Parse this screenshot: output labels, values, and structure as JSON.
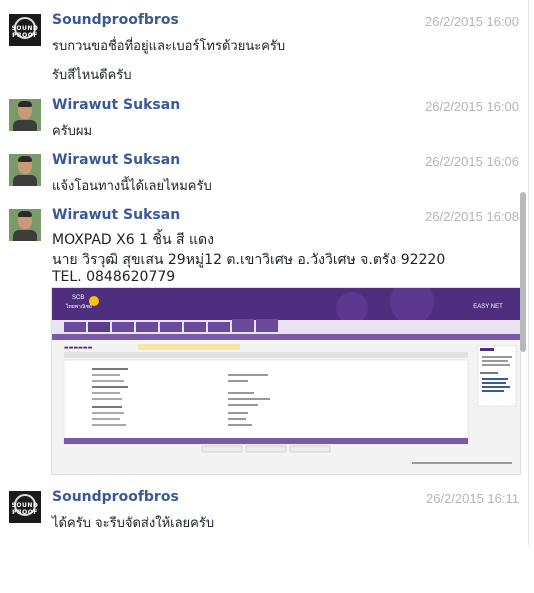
{
  "messages": [
    {
      "sender": "Soundproofbros",
      "avatar": "soundproof-logo",
      "time": "26/2/2015 16:00",
      "lines": [
        "รบกวนขอชื่อที่อยู่และเบอร์โทรด้วยนะครับ",
        "รับสีไหนดีครับ"
      ]
    },
    {
      "sender": "Wirawut Suksan",
      "avatar": "user-photo",
      "time": "26/2/2015 16:00",
      "lines": [
        "ครับผม"
      ]
    },
    {
      "sender": "Wirawut Suksan",
      "avatar": "user-photo",
      "time": "26/2/2015 16:06",
      "lines": [
        "แจ้งโอนทางนี้ได้เลยไหมครับ"
      ]
    },
    {
      "sender": "Wirawut Suksan",
      "avatar": "user-photo",
      "time": "26/2/2015 16:08",
      "lines": [
        "MOXPAD X6  1 ชิ้น สี แดง",
        "นาย วิรวุฒิ สุขเสน 29หมู่12 ต.เขาวิเศษ อ.วังวิเศษ จ.ตรัง 92220",
        "TEL. 0848620779"
      ]
    },
    {
      "sender": "Soundproofbros",
      "avatar": "soundproof-logo",
      "time": "26/2/2015 16:11",
      "lines": [
        "ได้ครับ จะรีบจัดส่งให้เลยครับ"
      ]
    }
  ],
  "avatar_text": "SOUND PROOF",
  "attachment": {
    "bank_logo": "SCB",
    "bank_name": "ไทยพาณิชย์",
    "service": "EASY NET",
    "colors": {
      "brand": "#4f2d7f",
      "accent": "#f5c400"
    }
  },
  "colors": {
    "sender": "#3b5998",
    "time": "#b5b5b5",
    "text": "#1d2129"
  }
}
